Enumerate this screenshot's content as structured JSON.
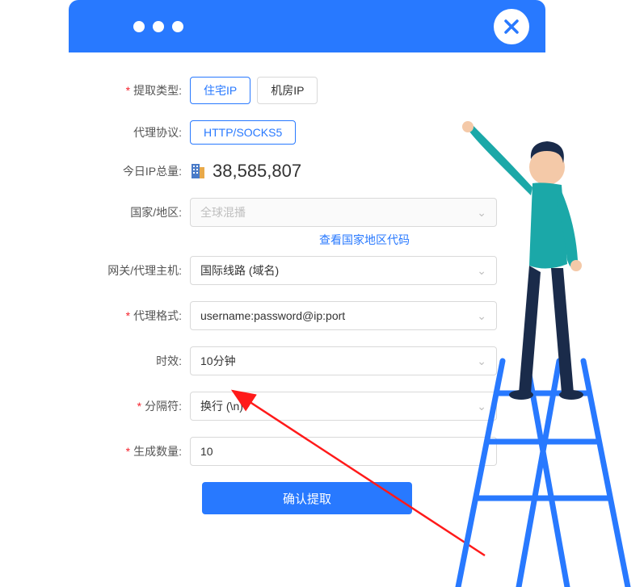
{
  "form": {
    "extract_type": {
      "label": "提取类型:",
      "options": [
        "住宅IP",
        "机房IP"
      ],
      "selected": 0
    },
    "proxy_protocol": {
      "label": "代理协议:",
      "value": "HTTP/SOCKS5"
    },
    "ip_total": {
      "label": "今日IP总量:",
      "value": "38,585,807"
    },
    "country_region": {
      "label": "国家/地区:",
      "value": "全球混播"
    },
    "country_code_link": "查看国家地区代码",
    "gateway_host": {
      "label": "网关/代理主机:",
      "value": "国际线路 (域名)"
    },
    "proxy_format": {
      "label": "代理格式:",
      "value": "username:password@ip:port"
    },
    "duration": {
      "label": "时效:",
      "value": "10分钟"
    },
    "separator": {
      "label": "分隔符:",
      "value": "换行 (\\n)"
    },
    "generate_count": {
      "label": "生成数量:",
      "value": "10"
    },
    "submit_label": "确认提取"
  }
}
